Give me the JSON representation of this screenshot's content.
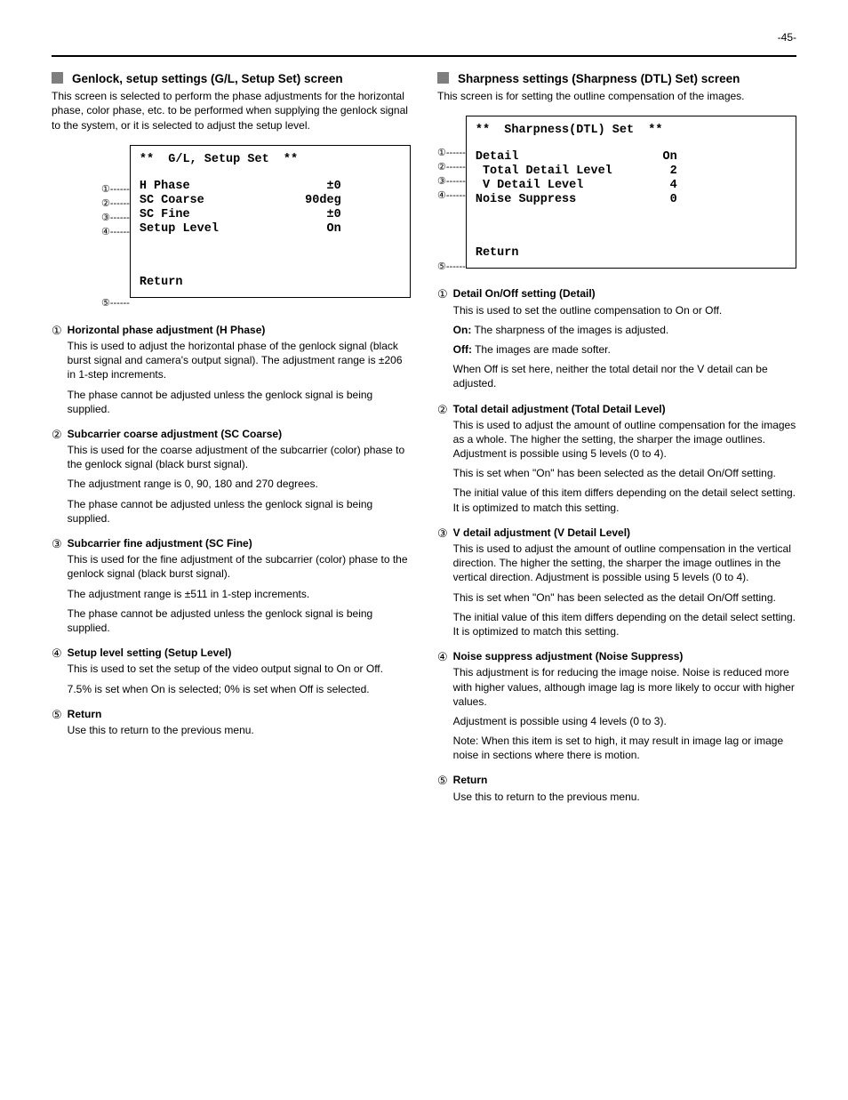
{
  "page_number": "-45-",
  "left": {
    "title": "Genlock, setup settings (G/L, Setup Set) screen",
    "desc": "This screen is selected to perform the phase adjustments for the horizontal phase, color phase, etc. to be performed when supplying the genlock signal to the system, or it is selected to adjust the setup level.",
    "osd": {
      "title": " G/L, Setup Set ",
      "rows": [
        {
          "label": "H Phase",
          "value": "±0"
        },
        {
          "label": "SC Coarse",
          "value": "90deg"
        },
        {
          "label": "SC Fine",
          "value": "±0"
        },
        {
          "label": "Setup Level",
          "value": "On"
        }
      ],
      "return": "Return"
    },
    "markers": [
      "①------",
      "②------",
      "③------",
      "④------",
      "",
      "",
      "",
      "",
      "⑤------"
    ],
    "items": [
      {
        "num": "①",
        "title": "Horizontal phase adjustment (H Phase)",
        "body": "<p>This is used to adjust the horizontal phase of the genlock signal (black burst signal and camera's output signal). The adjustment range is ±206 in 1-step increments.</p><p>The phase cannot be adjusted unless the genlock signal is being supplied.</p>"
      },
      {
        "num": "②",
        "title": "Subcarrier coarse adjustment (SC Coarse)",
        "body": "<p>This is used for the coarse adjustment of the subcarrier (color) phase to the genlock signal (black burst signal).</p><p>The adjustment range is 0, 90, 180 and 270 degrees.</p><p>The phase cannot be adjusted unless the genlock signal is being supplied.</p>"
      },
      {
        "num": "③",
        "title": "Subcarrier fine adjustment (SC Fine)",
        "body": "<p>This is used for the fine adjustment of the subcarrier (color) phase to the genlock signal (black burst signal).</p><p>The adjustment range is ±511 in 1-step increments.</p><p>The phase cannot be adjusted unless the genlock signal is being supplied.</p>"
      },
      {
        "num": "④",
        "title": "Setup level setting (Setup Level)",
        "body": "<p>This is used to set the setup of the video output signal to On or Off.</p><p>7.5% is set when On is selected; 0% is set when Off is selected.</p>"
      },
      {
        "num": "⑤",
        "title": "Return",
        "body": "<p>Use this to return to the previous menu.</p>"
      }
    ]
  },
  "right": {
    "title": "Sharpness settings (Sharpness (DTL) Set) screen",
    "desc": "This screen is for setting the outline compensation of the images.",
    "osd": {
      "title": " Sharpness(DTL) Set ",
      "rows": [
        {
          "label": "Detail",
          "value": "On"
        },
        {
          "label": " Total Detail Level",
          "value": "2"
        },
        {
          "label": " V Detail Level",
          "value": "4"
        },
        {
          "label": "Noise Suppress",
          "value": "0"
        }
      ],
      "return": "Return"
    },
    "markers": [
      "①------",
      "②------",
      "③------",
      "④------",
      "",
      "",
      "",
      "",
      "⑤------"
    ],
    "items": [
      {
        "num": "①",
        "title": "Detail On/Off setting (Detail)",
        "body": "<p>This is used to set the outline compensation to On or Off.</p><p><b>On:</b> The sharpness of the images is adjusted.</p><p><b>Off:</b> The images are made softer.</p><p>When Off is set here, neither the total detail nor the V detail can be adjusted.</p>"
      },
      {
        "num": "②",
        "title": "Total detail adjustment (Total Detail Level)",
        "body": "<p>This is used to adjust the amount of outline compensation for the images as a whole. The higher the setting, the sharper the image outlines. Adjustment is possible using 5 levels (0 to 4).</p><p>This is set when &quot;On&quot; has been selected as the detail On/Off setting.</p><p>The initial value of this item differs depending on the detail select setting. It is optimized to match this setting.</p>"
      },
      {
        "num": "③",
        "title": "V detail adjustment (V Detail Level)",
        "body": "<p>This is used to adjust the amount of outline compensation in the vertical direction. The higher the setting, the sharper the image outlines in the vertical direction. Adjustment is possible using 5 levels (0 to 4).</p><p>This is set when &quot;On&quot; has been selected as the detail On/Off setting.</p><p>The initial value of this item differs depending on the detail select setting. It is optimized to match this setting.</p>"
      },
      {
        "num": "④",
        "title": "Noise suppress adjustment (Noise Suppress)",
        "body": "<p>This adjustment is for reducing the image noise. Noise is reduced more with higher values, although image lag is more likely to occur with higher values.</p><p>Adjustment is possible using 4 levels (0 to 3).</p><p><span class='note-lab'>Note:</span> When this item is set to high, it may result in image lag or image noise in sections where there is motion.</p>"
      },
      {
        "num": "⑤",
        "title": "Return",
        "body": "<p>Use this to return to the previous menu.</p>"
      }
    ]
  }
}
